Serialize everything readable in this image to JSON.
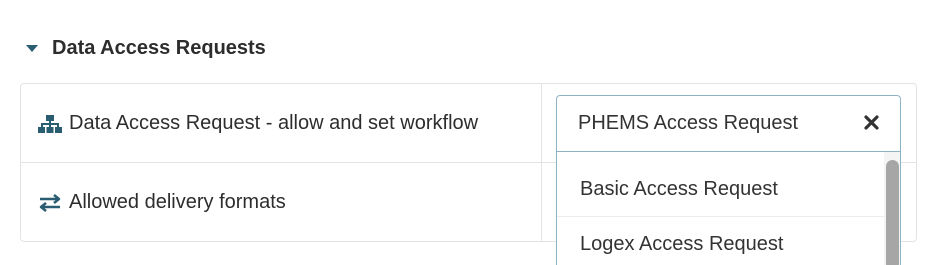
{
  "section": {
    "title": "Data Access Requests",
    "expanded": true,
    "toggle_icon": "caret-down-icon"
  },
  "rows": [
    {
      "label": "Data Access Request - allow and set workflow",
      "icon": "sitemap-icon"
    },
    {
      "label": "Allowed delivery formats",
      "icon": "exchange-arrows-icon"
    }
  ],
  "workflow_select": {
    "value": "PHEMS Access Request",
    "clear_icon": "close-icon",
    "options": [
      "Basic Access Request",
      "Logex Access Request"
    ]
  },
  "colors": {
    "accent": "#2a5d72",
    "border": "#e3e3e3",
    "focus_border": "#8fb3c6",
    "text": "#2d2d2d"
  }
}
